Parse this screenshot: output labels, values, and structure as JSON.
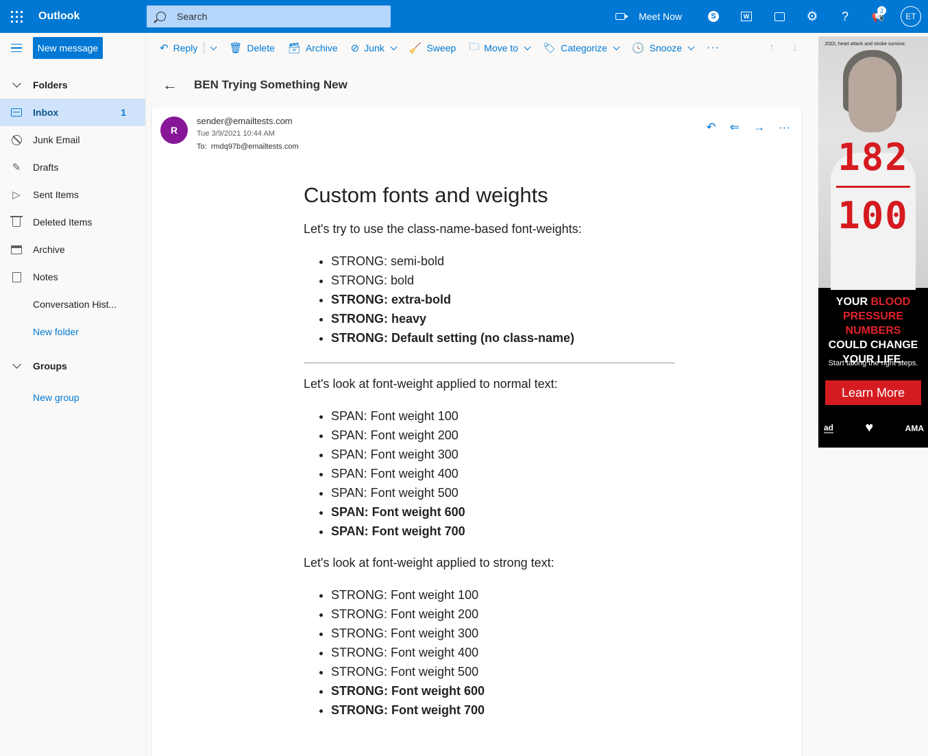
{
  "topbar": {
    "app_name": "Outlook",
    "search_placeholder": "Search",
    "meet_now": "Meet Now",
    "notification_count": "2",
    "user_initials": "ET"
  },
  "nav": {
    "new_message": "New message",
    "folders_label": "Folders",
    "items": [
      {
        "label": "Inbox",
        "count": "1"
      },
      {
        "label": "Junk Email"
      },
      {
        "label": "Drafts"
      },
      {
        "label": "Sent Items"
      },
      {
        "label": "Deleted Items"
      },
      {
        "label": "Archive"
      },
      {
        "label": "Notes"
      },
      {
        "label": "Conversation Hist..."
      }
    ],
    "new_folder": "New folder",
    "groups_label": "Groups",
    "new_group": "New group"
  },
  "commands": {
    "reply": "Reply",
    "delete": "Delete",
    "archive": "Archive",
    "junk": "Junk",
    "sweep": "Sweep",
    "move_to": "Move to",
    "categorize": "Categorize",
    "snooze": "Snooze"
  },
  "message": {
    "subject": "BEN Trying Something New",
    "sender_initial": "R",
    "from": "sender@emailtests.com",
    "date": "Tue 3/9/2021 10:44 AM",
    "to_label": "To:",
    "to": "rmdq97b@emailtests.com",
    "heading": "Custom fonts and weights",
    "intro1": "Let's try to use the class-name-based font-weights:",
    "list1": [
      "STRONG: semi-bold",
      "STRONG: bold",
      "STRONG: extra-bold",
      "STRONG: heavy",
      "STRONG: Default setting (no class-name)"
    ],
    "intro2": "Let's look at font-weight applied to normal text:",
    "list2": [
      "SPAN: Font weight 100",
      "SPAN: Font weight 200",
      "SPAN: Font weight 300",
      "SPAN: Font weight 400",
      "SPAN: Font weight 500",
      "SPAN: Font weight 600",
      "SPAN: Font weight 700"
    ],
    "intro3": "Let's look at font-weight applied to strong text:",
    "list3": [
      "STRONG: Font weight 100",
      "STRONG: Font weight 200",
      "STRONG: Font weight 300",
      "STRONG: Font weight 400",
      "STRONG: Font weight 500",
      "STRONG: Font weight 600",
      "STRONG: Font weight 700"
    ]
  },
  "ad": {
    "caption": "JODI, heart attack and stroke survivor.",
    "systolic": "182",
    "diastolic": "100",
    "line1": "YOUR ",
    "line1_red": "BLOOD",
    "line2": "PRESSURE NUMBERS",
    "line3": "COULD CHANGE",
    "line4": "YOUR LIFE.",
    "sub": "Start taking the right steps.",
    "cta": "Learn More",
    "logo1": "ad",
    "logo3": "AMA"
  },
  "colors": {
    "accent": "#0078d4",
    "selected_bg": "#cfe4fa",
    "avatar": "#881798",
    "ad_red": "#d51b20"
  }
}
